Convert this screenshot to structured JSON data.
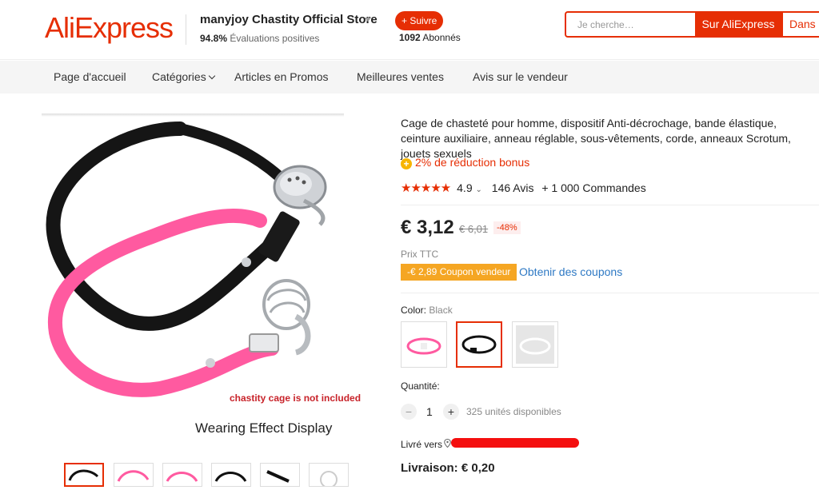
{
  "header": {
    "logo_text": "AliExpress",
    "store_name": "manyjoy Chastity Official Store",
    "rating_value": "94.8%",
    "rating_label": "Évaluations positives",
    "follow_label": "+ Suivre",
    "followers_count": "1092",
    "followers_label": "Abonnés",
    "search_placeholder": "Je cherche…",
    "search_button_1": "Sur AliExpress",
    "search_button_2": "Dans c"
  },
  "nav": {
    "items": [
      "Page d'accueil",
      "Catégories",
      "Articles en Promos",
      "Meilleures ventes",
      "Avis sur le vendeur"
    ]
  },
  "image": {
    "caption_red": "chastity cage is not included",
    "caption": "Wearing Effect Display"
  },
  "product": {
    "title": "Cage de chasteté pour homme, dispositif Anti-décrochage, bande élastique, ceinture auxiliaire, anneau réglable, sous-vêtements, corde, anneaux Scrotum, jouets sexuels",
    "bonus": "2% de réduction bonus",
    "rating": "4.9",
    "reviews": "146 Avis",
    "orders": "+ 1 000 Commandes",
    "price": "€ 3,12",
    "old_price": "€ 6,01",
    "discount": "-48%",
    "tax_note": "Prix TTC",
    "coupon": "-€ 2,89 Coupon vendeur",
    "coupon_link": "Obtenir des coupons",
    "color_label": "Color:",
    "color_value": "Black",
    "quantity_label": "Quantité:",
    "quantity": "1",
    "stock": "325 unités disponibles",
    "deliver_to": "Livré vers",
    "shipping": "Livraison: € 0,20"
  },
  "colors": {
    "accent": "#e62e04",
    "coupon": "#f5a623",
    "link": "#2e79c4"
  }
}
